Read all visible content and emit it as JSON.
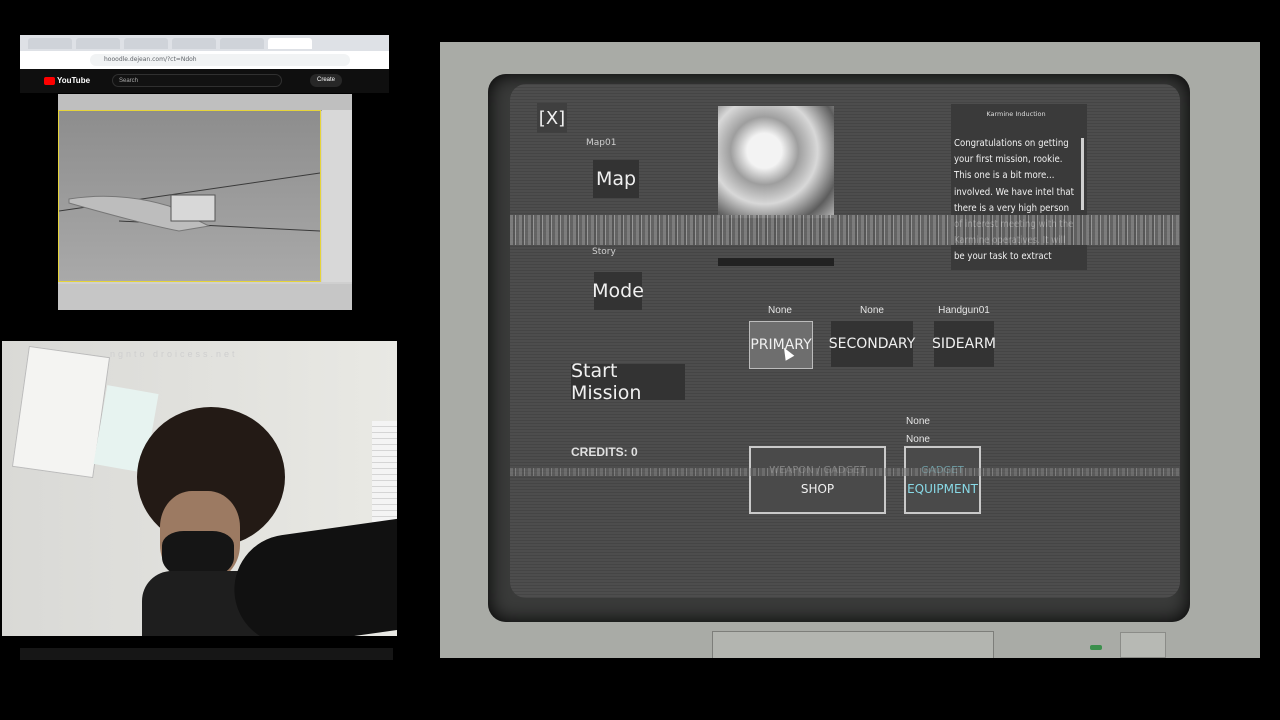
{
  "browser": {
    "url": "hooodle.dejean.com/?ct=Ndoh",
    "youtube_logo": "YouTube",
    "search_placeholder": "Search",
    "create_label": "Create"
  },
  "webcam": {
    "wall_text": "ngnto droicess.net"
  },
  "game_ui": {
    "close_label": "[X]",
    "map_caption": "Map01",
    "map_label": "Map",
    "mode_caption": "Story",
    "mode_label": "Mode",
    "start_label": "Start Mission",
    "credits": "CREDITS: 0",
    "story": {
      "header": "Karmine Induction",
      "text": "Congratulations on getting your first mission, rookie. This one is a bit more... involved. We have intel that there is a very high person of interest meeting with the Karmine operatives. It will be your task to extract"
    },
    "weapons": [
      {
        "slot_label": "PRIMARY",
        "equipped": "None"
      },
      {
        "slot_label": "SECONDARY",
        "equipped": "None"
      },
      {
        "slot_label": "SIDEARM",
        "equipped": "Handgun01"
      }
    ],
    "equipment_slots": [
      "None",
      "None"
    ],
    "shop_label": "SHOP",
    "shop_label_top": "WEAPON / GADGET",
    "equipment_label": "EQUIPMENT",
    "equipment_label_top": "GADGET"
  },
  "colors": {
    "crt_bg": "#4d4d4d",
    "monitor_shell": "#a9aba6",
    "equipment_text": "#88d9e6"
  }
}
